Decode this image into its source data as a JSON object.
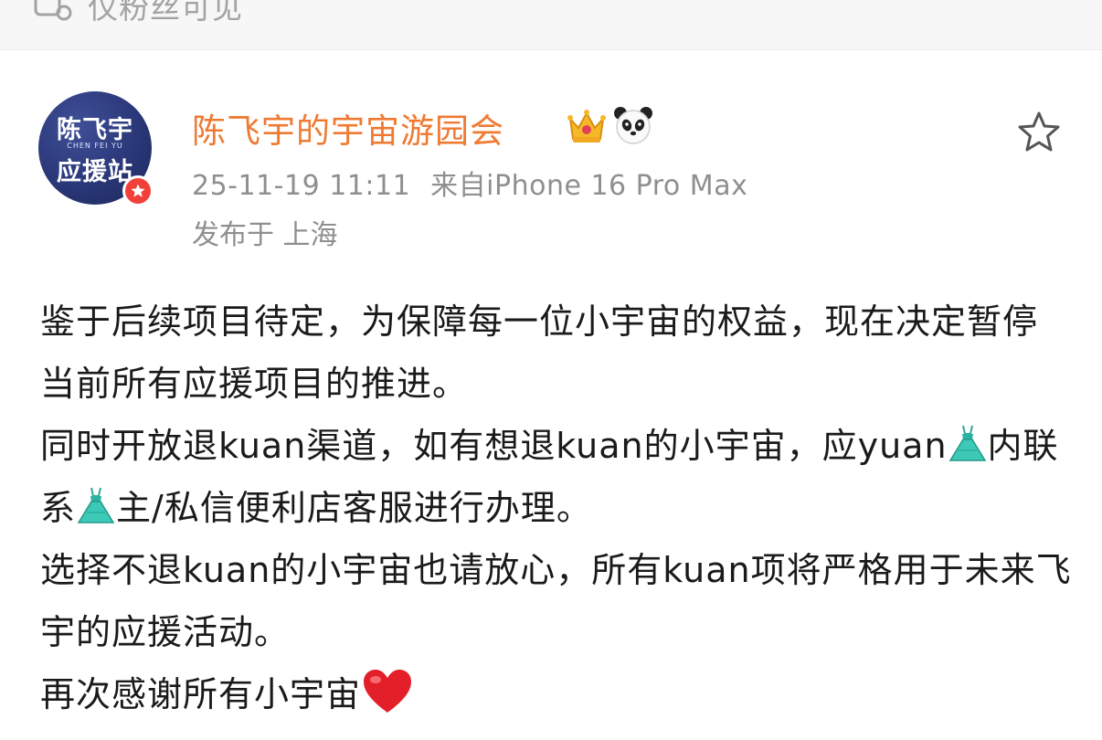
{
  "visibility": {
    "icon": "lock-people-icon",
    "label": "仅粉丝可见"
  },
  "post": {
    "avatar": {
      "line1": "陈飞宇",
      "line2": "CHEN FEI YU",
      "line3": "应援站",
      "badge_icon": "vip-star-icon",
      "colors": {
        "bg": "#2a3778",
        "badge": "#f1403a"
      }
    },
    "author": "陈飞宇的宇宙游园会",
    "author_color": "#ef7a33",
    "badges": [
      "crown-icon",
      "panda-icon"
    ],
    "favorite_icon": "star-outline-icon",
    "timestamp": "25-11-19 11:11",
    "source": "来自iPhone 16 Pro Max",
    "location": "发布于 上海",
    "body": {
      "p1": "鉴于后续项目待定，为保障每一位小宇宙的权益，现在决定暂停当前所有应援项目的推进。",
      "p2": "同时开放退kuan渠道，如有想退kuan的小宇宙，应yuan",
      "p2_mid": "内联系",
      "p2_end": "主/私信便利店客服进行办理。",
      "p3": "选择不退kuan的小宇宙也请放心，所有kuan项将严格用于未来飞宇的应援活动。",
      "p4": "再次感谢所有小宇宙",
      "emojis": [
        "dress-icon",
        "dress-icon",
        "red-heart-icon"
      ]
    }
  }
}
